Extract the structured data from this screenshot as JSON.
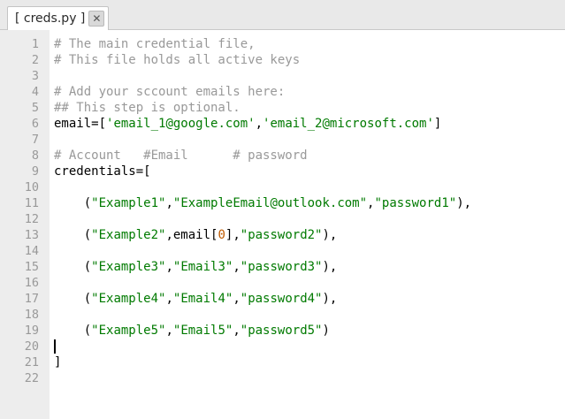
{
  "tab": {
    "title": "[ creds.py ]",
    "close_glyph": "✕"
  },
  "editor": {
    "current_line": 20,
    "lines": [
      {
        "number": "1",
        "tokens": [
          {
            "t": "comment",
            "v": "# The main credential file,"
          }
        ]
      },
      {
        "number": "2",
        "tokens": [
          {
            "t": "comment",
            "v": "# This file holds all active keys"
          }
        ]
      },
      {
        "number": "3",
        "tokens": []
      },
      {
        "number": "4",
        "tokens": [
          {
            "t": "comment",
            "v": "# Add your sccount emails here:"
          }
        ]
      },
      {
        "number": "5",
        "tokens": [
          {
            "t": "comment",
            "v": "## This step is optional."
          }
        ]
      },
      {
        "number": "6",
        "tokens": [
          {
            "t": "plain",
            "v": "email=["
          },
          {
            "t": "string",
            "v": "'email_1@google.com'"
          },
          {
            "t": "plain",
            "v": ","
          },
          {
            "t": "string",
            "v": "'email_2@microsoft.com'"
          },
          {
            "t": "plain",
            "v": "]"
          }
        ]
      },
      {
        "number": "7",
        "tokens": []
      },
      {
        "number": "8",
        "tokens": [
          {
            "t": "comment",
            "v": "# Account   #Email      # password"
          }
        ]
      },
      {
        "number": "9",
        "tokens": [
          {
            "t": "plain",
            "v": "credentials=["
          }
        ]
      },
      {
        "number": "10",
        "tokens": []
      },
      {
        "number": "11",
        "tokens": [
          {
            "t": "plain",
            "v": "    ("
          },
          {
            "t": "string",
            "v": "\"Example1\""
          },
          {
            "t": "plain",
            "v": ","
          },
          {
            "t": "string",
            "v": "\"ExampleEmail@outlook.com\""
          },
          {
            "t": "plain",
            "v": ","
          },
          {
            "t": "string",
            "v": "\"password1\""
          },
          {
            "t": "plain",
            "v": "),"
          }
        ]
      },
      {
        "number": "12",
        "tokens": []
      },
      {
        "number": "13",
        "tokens": [
          {
            "t": "plain",
            "v": "    ("
          },
          {
            "t": "string",
            "v": "\"Example2\""
          },
          {
            "t": "plain",
            "v": ",email["
          },
          {
            "t": "number",
            "v": "0"
          },
          {
            "t": "plain",
            "v": "],"
          },
          {
            "t": "string",
            "v": "\"password2\""
          },
          {
            "t": "plain",
            "v": "),"
          }
        ]
      },
      {
        "number": "14",
        "tokens": []
      },
      {
        "number": "15",
        "tokens": [
          {
            "t": "plain",
            "v": "    ("
          },
          {
            "t": "string",
            "v": "\"Example3\""
          },
          {
            "t": "plain",
            "v": ","
          },
          {
            "t": "string",
            "v": "\"Email3\""
          },
          {
            "t": "plain",
            "v": ","
          },
          {
            "t": "string",
            "v": "\"password3\""
          },
          {
            "t": "plain",
            "v": "),"
          }
        ]
      },
      {
        "number": "16",
        "tokens": []
      },
      {
        "number": "17",
        "tokens": [
          {
            "t": "plain",
            "v": "    ("
          },
          {
            "t": "string",
            "v": "\"Example4\""
          },
          {
            "t": "plain",
            "v": ","
          },
          {
            "t": "string",
            "v": "\"Email4\""
          },
          {
            "t": "plain",
            "v": ","
          },
          {
            "t": "string",
            "v": "\"password4\""
          },
          {
            "t": "plain",
            "v": "),"
          }
        ]
      },
      {
        "number": "18",
        "tokens": []
      },
      {
        "number": "19",
        "tokens": [
          {
            "t": "plain",
            "v": "    ("
          },
          {
            "t": "string",
            "v": "\"Example5\""
          },
          {
            "t": "plain",
            "v": ","
          },
          {
            "t": "string",
            "v": "\"Email5\""
          },
          {
            "t": "plain",
            "v": ","
          },
          {
            "t": "string",
            "v": "\"password5\""
          },
          {
            "t": "plain",
            "v": ")"
          }
        ]
      },
      {
        "number": "20",
        "tokens": []
      },
      {
        "number": "21",
        "tokens": [
          {
            "t": "plain",
            "v": "]"
          }
        ]
      },
      {
        "number": "22",
        "tokens": []
      }
    ]
  },
  "colors": {
    "comment": "#999999",
    "string": "#007a00",
    "number": "#c05a00",
    "gutter": "#ededed",
    "tabbar": "#e9e9e9"
  }
}
